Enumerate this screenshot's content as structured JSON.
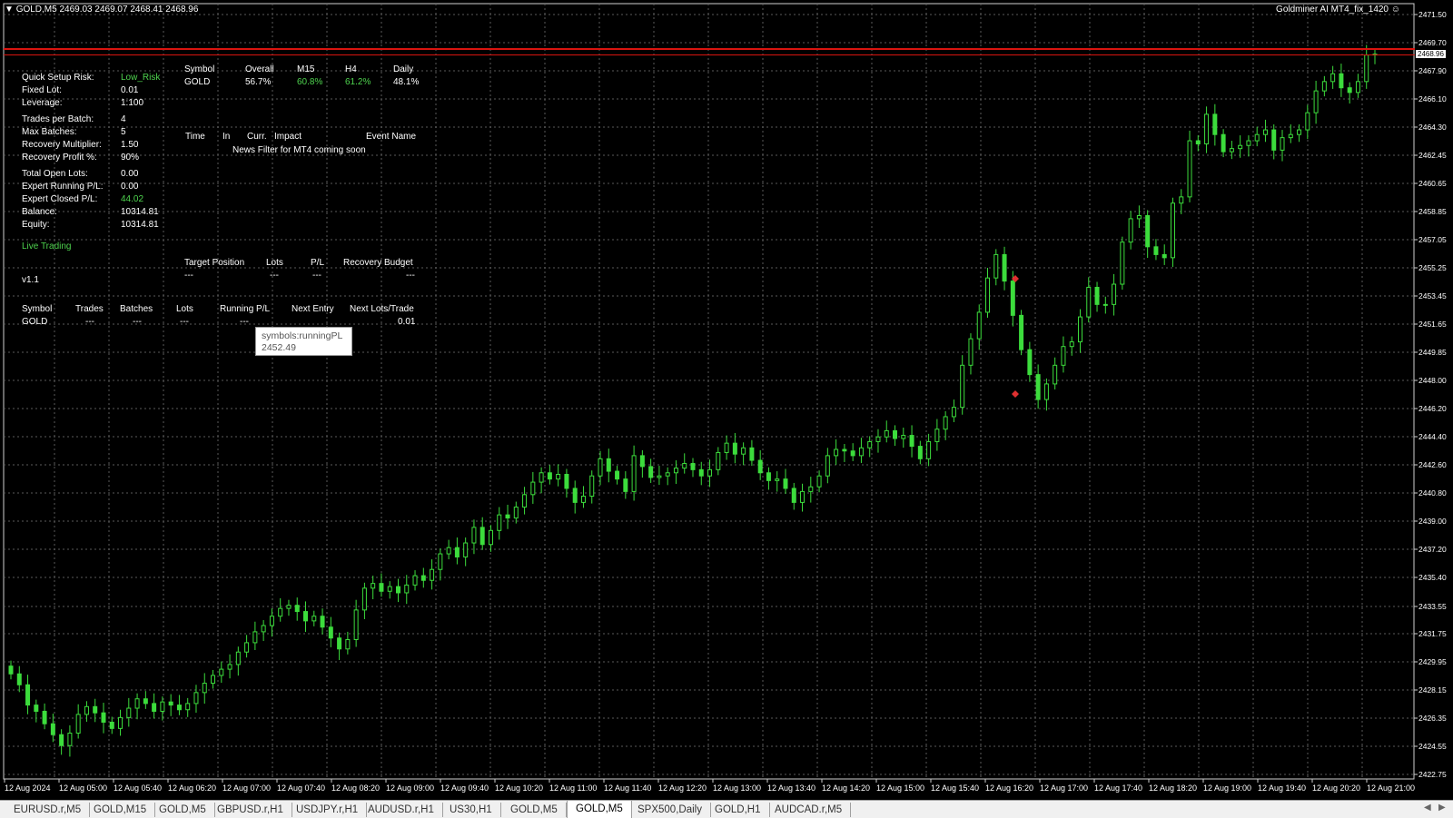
{
  "header": {
    "symbol_info": "GOLD,M5  2469.03 2469.07 2468.41 2468.96",
    "expert_name": "Goldminer AI MT4_fix_1420",
    "smiley_icon": "smiley-icon"
  },
  "settings_panel": {
    "rows": [
      {
        "label": "Quick Setup Risk:",
        "value": "Low_Risk",
        "green": true
      },
      {
        "label": "Fixed Lot:",
        "value": "0.01"
      },
      {
        "label": "Leverage:",
        "value": "1:100"
      },
      {
        "label": "Trades per Batch:",
        "value": "4"
      },
      {
        "label": "Max Batches:",
        "value": "5"
      },
      {
        "label": "Recovery Multiplier:",
        "value": "1.50"
      },
      {
        "label": "Recovery Profit %:",
        "value": "90%"
      },
      {
        "label": "Total Open Lots:",
        "value": "0.00"
      },
      {
        "label": "Expert Running P/L:",
        "value": "0.00"
      },
      {
        "label": "Expert Closed P/L:",
        "value": "44.02",
        "green": true
      },
      {
        "label": "Balance:",
        "value": "10314.81"
      },
      {
        "label": "Equity:",
        "value": "10314.81"
      }
    ],
    "status": "Live Trading",
    "version": "v1.1"
  },
  "performance_table": {
    "headers": [
      "Symbol",
      "Overall",
      "M15",
      "H4",
      "Daily"
    ],
    "row": [
      "GOLD",
      "56.7%",
      "60.8%",
      "61.2%",
      "48.1%"
    ]
  },
  "news_table": {
    "headers": [
      "Time",
      "In",
      "Curr.",
      "Impact",
      "Event Name"
    ],
    "message": "News Filter for MT4 coming soon"
  },
  "target_table": {
    "headers": [
      "Target Position",
      "Lots",
      "P/L",
      "Recovery Budget"
    ],
    "row": [
      "---",
      "---",
      "---",
      "---"
    ]
  },
  "positions_table": {
    "headers": [
      "Symbol",
      "Trades",
      "Batches",
      "Lots",
      "Running P/L",
      "Next Entry",
      "Next Lots/Trade"
    ],
    "row": [
      "GOLD",
      "---",
      "---",
      "---",
      "---",
      "",
      "0.01"
    ]
  },
  "tooltip": {
    "title": "symbols:runningPL",
    "value": "2452.49"
  },
  "price_axis": {
    "current_price": "2468.96",
    "ticks": [
      "2471.50",
      "2469.70",
      "2467.90",
      "2466.10",
      "2464.30",
      "2462.45",
      "2460.65",
      "2458.85",
      "2457.05",
      "2455.25",
      "2453.45",
      "2451.65",
      "2449.85",
      "2448.00",
      "2446.20",
      "2444.40",
      "2442.60",
      "2440.80",
      "2439.00",
      "2437.20",
      "2435.40",
      "2433.55",
      "2431.75",
      "2429.95",
      "2428.15",
      "2426.35",
      "2424.55",
      "2422.75"
    ]
  },
  "time_axis": {
    "ticks": [
      "12 Aug 2024",
      "12 Aug 05:00",
      "12 Aug 05:40",
      "12 Aug 06:20",
      "12 Aug 07:00",
      "12 Aug 07:40",
      "12 Aug 08:20",
      "12 Aug 09:00",
      "12 Aug 09:40",
      "12 Aug 10:20",
      "12 Aug 11:00",
      "12 Aug 11:40",
      "12 Aug 12:20",
      "12 Aug 13:00",
      "12 Aug 13:40",
      "12 Aug 14:20",
      "12 Aug 15:00",
      "12 Aug 15:40",
      "12 Aug 16:20",
      "12 Aug 17:00",
      "12 Aug 17:40",
      "12 Aug 18:20",
      "12 Aug 19:00",
      "12 Aug 19:40",
      "12 Aug 20:20",
      "12 Aug 21:00"
    ]
  },
  "chart_data": {
    "type": "candlestick",
    "symbol": "GOLD",
    "timeframe": "M5",
    "ylim": [
      2422.75,
      2471.5
    ],
    "bull_color": "#3cdc3c",
    "grid": true,
    "closes": [
      2429.2,
      2428.5,
      2427.2,
      2426.8,
      2426.0,
      2425.3,
      2424.6,
      2425.4,
      2426.6,
      2427.1,
      2426.7,
      2426.1,
      2425.7,
      2426.4,
      2427.0,
      2427.6,
      2427.3,
      2426.8,
      2427.4,
      2427.2,
      2426.9,
      2427.3,
      2428.0,
      2428.6,
      2429.1,
      2429.5,
      2429.8,
      2430.6,
      2431.2,
      2431.9,
      2432.3,
      2432.9,
      2433.4,
      2433.6,
      2433.2,
      2432.6,
      2432.9,
      2432.2,
      2431.5,
      2430.8,
      2431.4,
      2433.3,
      2434.7,
      2435.0,
      2434.5,
      2434.8,
      2434.4,
      2434.9,
      2435.5,
      2435.2,
      2435.9,
      2436.9,
      2437.3,
      2436.7,
      2437.6,
      2438.6,
      2437.5,
      2438.4,
      2439.4,
      2439.2,
      2439.9,
      2440.7,
      2441.5,
      2442.1,
      2441.7,
      2442.0,
      2441.1,
      2440.2,
      2440.6,
      2441.9,
      2443.0,
      2442.2,
      2441.7,
      2440.9,
      2443.2,
      2442.5,
      2441.8,
      2441.9,
      2442.1,
      2442.4,
      2442.7,
      2442.3,
      2441.9,
      2442.3,
      2443.4,
      2444.0,
      2443.3,
      2443.7,
      2442.9,
      2442.1,
      2441.6,
      2441.7,
      2441.1,
      2440.2,
      2440.9,
      2441.2,
      2441.9,
      2443.2,
      2443.6,
      2443.5,
      2443.2,
      2443.7,
      2444.1,
      2444.4,
      2444.8,
      2444.3,
      2444.5,
      2443.8,
      2443.0,
      2444.1,
      2444.9,
      2445.7,
      2446.3,
      2449.0,
      2450.7,
      2452.4,
      2454.6,
      2456.1,
      2454.4,
      2452.2,
      2450.0,
      2448.4,
      2446.8,
      2447.8,
      2449.0,
      2450.2,
      2450.5,
      2452.1,
      2454.0,
      2452.9,
      2452.9,
      2454.2,
      2456.9,
      2458.4,
      2458.6,
      2456.6,
      2456.1,
      2455.9,
      2459.4,
      2459.8,
      2463.4,
      2463.2,
      2465.1,
      2463.8,
      2462.7,
      2462.9,
      2463.1,
      2463.4,
      2463.8,
      2464.1,
      2462.8,
      2463.6,
      2463.8,
      2464.1,
      2465.2,
      2466.6,
      2467.2,
      2467.7,
      2466.8,
      2466.5,
      2467.2,
      2468.9,
      2468.96
    ]
  }
}
